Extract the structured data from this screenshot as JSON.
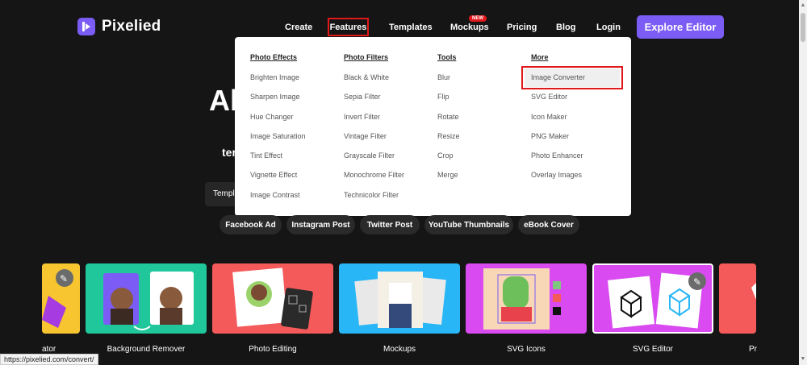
{
  "brand": {
    "name": "Pixelied"
  },
  "nav": {
    "items": [
      "Create",
      "Features",
      "Templates",
      "Mockups",
      "Pricing",
      "Blog",
      "Login"
    ],
    "new_badge": "NEW",
    "cta": "Explore Editor"
  },
  "hero": {
    "title_partial": "Al",
    "subtitle_partial": "ter",
    "tab_partial": "Templa"
  },
  "menu": {
    "columns": [
      {
        "heading": "Photo Effects",
        "items": [
          "Brighten Image",
          "Sharpen Image",
          "Hue Changer",
          "Image Saturation",
          "Tint Effect",
          "Vignette Effect",
          "Image Contrast"
        ]
      },
      {
        "heading": "Photo Filters",
        "items": [
          "Black & White",
          "Sepia Filter",
          "Invert Filter",
          "Vintage Filter",
          "Grayscale Filter",
          "Monochrome Filter",
          "Technicolor Filter"
        ]
      },
      {
        "heading": "Tools",
        "items": [
          "Blur",
          "Flip",
          "Rotate",
          "Resize",
          "Crop",
          "Merge"
        ]
      },
      {
        "heading": "More",
        "items": [
          "Image Converter",
          "SVG Editor",
          "Icon Maker",
          "PNG Maker",
          "Photo Enhancer",
          "Overlay Images"
        ]
      }
    ]
  },
  "tags": [
    "Facebook Ad",
    "Instagram Post",
    "Twitter Post",
    "YouTube Thumbnails",
    "eBook Cover"
  ],
  "cards": [
    "ator",
    "Background Remover",
    "Photo Editing",
    "Mockups",
    "SVG Icons",
    "SVG Editor",
    "Pr"
  ],
  "status_url": "https://pixelied.com/convert/",
  "colors": {
    "accent": "#7b5cf5",
    "highlight": "#e0181c",
    "bg": "#151515"
  }
}
